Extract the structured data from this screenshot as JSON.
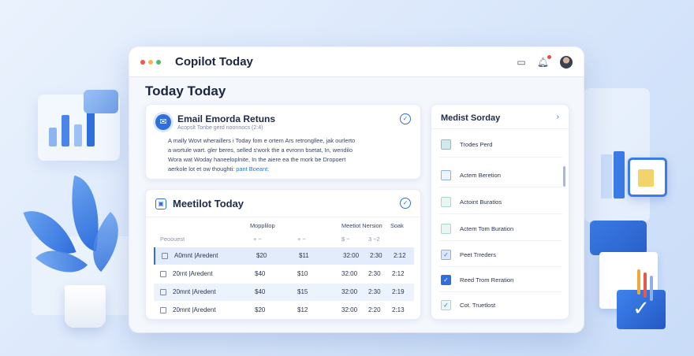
{
  "window": {
    "title": "Copilot Today",
    "traffic_colors": [
      "#e8584b",
      "#f2b84a",
      "#4fb872"
    ]
  },
  "page": {
    "title": "Today Today"
  },
  "email_card": {
    "title": "Email Emorda Retuns",
    "subtitle": "Acopslt Tonbe gerd noonnocs (2:4)",
    "lines": [
      "A mally Wovt wheraillers i Today fom e ortem Ars retrongllee, jak ourlerto",
      "a wortule wart. gler beres, selled s'work the a evronn bsetat, In, wendilo",
      "Wora wat Woday haneeloplnite, In the aiere ea the mork be Dropoert"
    ],
    "last_line_prefix": "aerkole lot et ow thoughti",
    "link_text": "pant Boeant:"
  },
  "meeting_card": {
    "title": "Meetilot Today",
    "headers": {
      "col1": "Mopplilop",
      "col2": "Meetiot Nersion",
      "col3": "Soak",
      "left": "Peoouest",
      "sub1": "+ −",
      "sub2": "+ −",
      "sub3": "$ −",
      "sub4": "3 −2"
    },
    "rows": [
      {
        "name": "A0mnt  |Aredent",
        "a": "$20",
        "b": "$11",
        "c": "32:00",
        "d": "2:30",
        "e": "2:12"
      },
      {
        "name": "20rnt  |Aredent",
        "a": "$40",
        "b": "$10",
        "c": "32:00",
        "d": "2:30",
        "e": "2:12"
      },
      {
        "name": "20mnt  |Aredent",
        "a": "$40",
        "b": "$15",
        "c": "32:00",
        "d": "2:30",
        "e": "2:19"
      },
      {
        "name": "20mnt  |Aredent",
        "a": "$20",
        "b": "$12",
        "c": "32:00",
        "d": "2:20",
        "e": "2:13"
      }
    ]
  },
  "side_card": {
    "title": "Medist Sorday",
    "items": [
      {
        "label": "Trodes Perd",
        "mark": ""
      },
      {
        "label": "Actem Beretion",
        "mark": ""
      },
      {
        "label": "Actoint Buratios",
        "mark": ""
      },
      {
        "label": "Actem Tom Buration",
        "mark": ""
      },
      {
        "label": "Peet Trreders",
        "mark": "✓"
      },
      {
        "label": "Reed Trom Reration",
        "mark": "✓"
      },
      {
        "label": "Cot. Truetlost",
        "mark": "✓"
      }
    ]
  },
  "icons": {
    "mail": "mail-icon",
    "calendar": "calendar-icon",
    "notifications": "bell-icon",
    "messages": "message-icon"
  },
  "colors": {
    "accent": "#2f6fdc"
  }
}
